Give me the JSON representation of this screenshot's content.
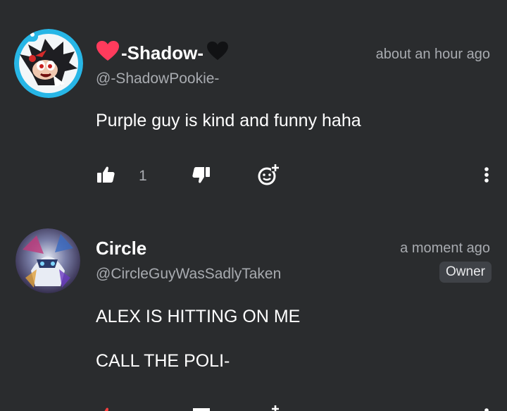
{
  "comments": [
    {
      "author": {
        "display_name": "-Shadow-",
        "handle": "@-ShadowPookie-"
      },
      "timestamp": "about an hour ago",
      "text": [
        "Purple guy is kind and funny haha"
      ],
      "likes": "1",
      "name_decoration": {
        "left": "red-heart-icon",
        "right": "black-heart-icon"
      }
    },
    {
      "author": {
        "display_name": "Circle",
        "handle": "@CircleGuyWasSadlyTaken"
      },
      "timestamp": "a moment ago",
      "badge": "Owner",
      "text": [
        "ALEX IS HITTING ON ME",
        "CALL THE POLI-"
      ]
    }
  ],
  "colors": {
    "background": "#2a2c2e",
    "muted_text": "#a8abb0",
    "avatar_ring": "#27b6e6",
    "badge_bg": "#3f4247"
  }
}
